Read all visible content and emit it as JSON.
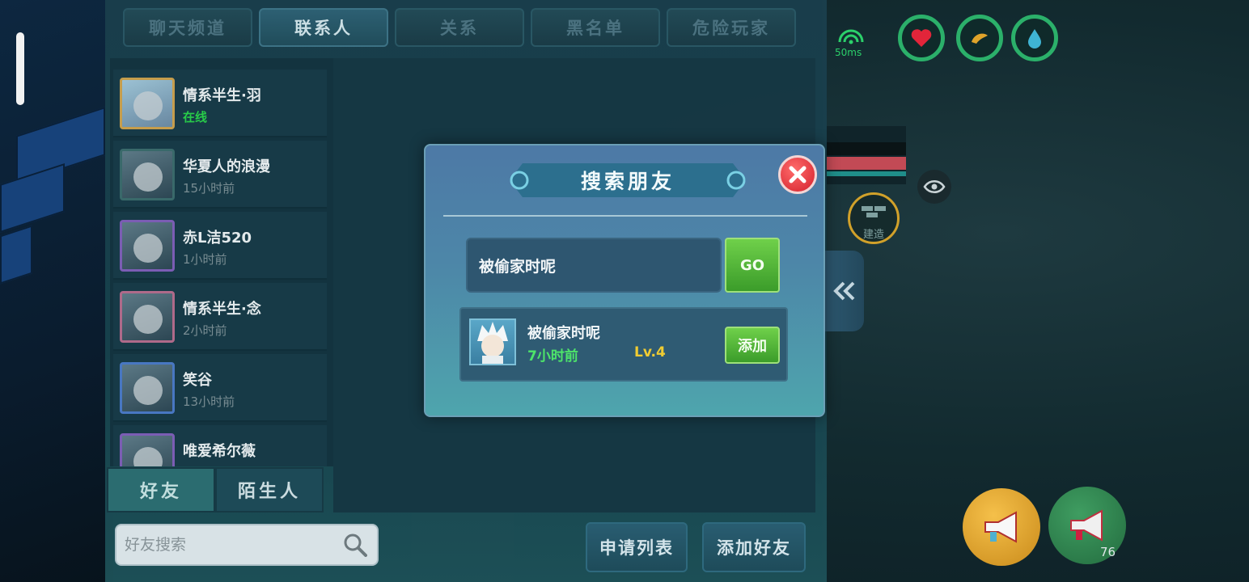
{
  "panel": {
    "tabs": [
      {
        "label": "聊天频道"
      },
      {
        "label": "联系人"
      },
      {
        "label": "关系"
      },
      {
        "label": "黑名单"
      },
      {
        "label": "危险玩家"
      }
    ],
    "friends": [
      {
        "name": "情系半生·羽",
        "status": "在线"
      },
      {
        "name": "华夏人的浪漫",
        "status": "15小时前"
      },
      {
        "name": "赤L洁520",
        "status": "1小时前"
      },
      {
        "name": "情系半生·念",
        "status": "2小时前"
      },
      {
        "name": "笑谷",
        "status": "13小时前"
      },
      {
        "name": "唯爱希尔薇",
        "status": ""
      }
    ],
    "subtabs": [
      {
        "label": "好友"
      },
      {
        "label": "陌生人"
      }
    ],
    "search": {
      "placeholder": "好友搜索"
    },
    "buttons": {
      "request_list": "申请列表",
      "add_friend": "添加好友"
    }
  },
  "hud": {
    "ping": "50ms",
    "build_label": "建造",
    "megaphone_count": "76",
    "colors": {
      "ring": "#2bb06a",
      "health": "#c24a55"
    }
  },
  "modal": {
    "title": "搜索朋友",
    "search_value": "被偷家时呢",
    "go_label": "GO",
    "result": {
      "name": "被偷家时呢",
      "time": "7小时前",
      "level": "Lv.4",
      "add_label": "添加"
    }
  }
}
